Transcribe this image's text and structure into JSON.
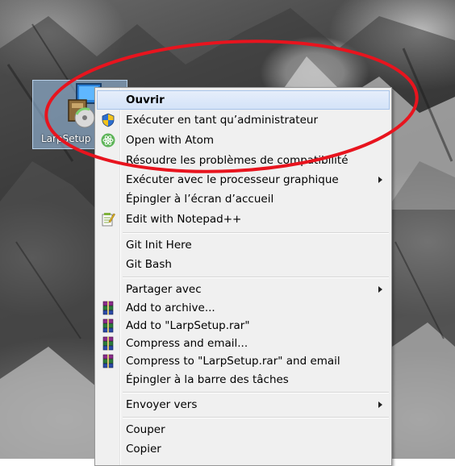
{
  "desktop_icon": {
    "label": "LarpSetup"
  },
  "menu": {
    "items": [
      {
        "label": "Ouvrir",
        "bold": true,
        "highlighted": true
      },
      {
        "label": "Exécuter en tant qu’administrateur",
        "icon": "uac-shield-icon"
      },
      {
        "label": "Open with Atom",
        "icon": "atom-icon"
      },
      {
        "label": "Résoudre les problèmes de compatibilité"
      },
      {
        "label": "Exécuter avec le processeur graphique",
        "submenu": true
      },
      {
        "label": "Épingler à l’écran d’accueil"
      },
      {
        "label": "Edit with Notepad++",
        "icon": "notepad-plus-plus-icon"
      },
      {
        "label": "Git Init Here"
      },
      {
        "label": "Git Bash"
      },
      {
        "label": "Partager avec",
        "submenu": true
      },
      {
        "label": "Add to archive...",
        "icon": "winrar-icon"
      },
      {
        "label": "Add to \"LarpSetup.rar\"",
        "icon": "winrar-icon"
      },
      {
        "label": "Compress and email...",
        "icon": "winrar-icon"
      },
      {
        "label": "Compress to \"LarpSetup.rar\" and email",
        "icon": "winrar-icon"
      },
      {
        "label": "Épingler à la barre des tâches"
      },
      {
        "label": "Envoyer vers",
        "submenu": true
      },
      {
        "label": "Couper"
      },
      {
        "label": "Copier"
      }
    ]
  },
  "colors": {
    "annotation": "#e8141e",
    "highlight": "#d4e3f8"
  }
}
